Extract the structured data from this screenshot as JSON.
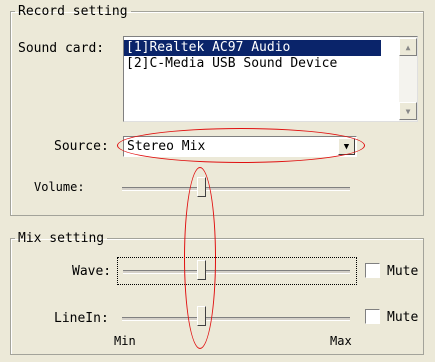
{
  "record": {
    "legend": "Record setting",
    "sound_card_label": "Sound card:",
    "devices": [
      "[1]Realtek AC97 Audio",
      "[2]C-Media USB Sound Device"
    ],
    "selected_device_index": 0,
    "source_label": "Source:",
    "source_value": "Stereo Mix",
    "volume_label": "Volume:",
    "volume_level": 0.33
  },
  "mix": {
    "legend": "Mix setting",
    "wave_label": "Wave:",
    "wave_level": 0.33,
    "wave_mute_label": "Mute",
    "wave_muted": false,
    "linein_label": "LineIn:",
    "linein_level": 0.33,
    "linein_mute_label": "Mute",
    "linein_muted": false,
    "min_label": "Min",
    "max_label": "Max"
  },
  "annotation_color": "#e01010"
}
